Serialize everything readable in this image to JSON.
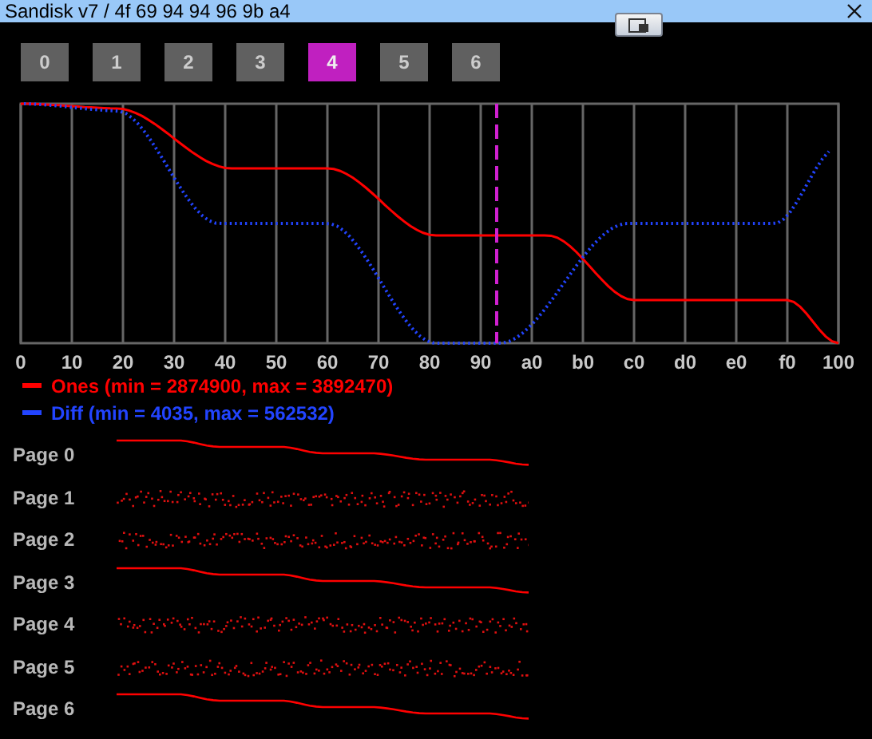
{
  "window": {
    "title": "Sandisk v7 / 4f 69 94 94 96 9b a4"
  },
  "page_buttons": [
    {
      "label": "0",
      "selected": false
    },
    {
      "label": "1",
      "selected": false
    },
    {
      "label": "2",
      "selected": false
    },
    {
      "label": "3",
      "selected": false
    },
    {
      "label": "4",
      "selected": true
    },
    {
      "label": "5",
      "selected": false
    },
    {
      "label": "6",
      "selected": false
    }
  ],
  "graph": {
    "x_labels": [
      "0",
      "10",
      "20",
      "30",
      "40",
      "50",
      "60",
      "70",
      "80",
      "90",
      "a0",
      "b0",
      "c0",
      "d0",
      "e0",
      "f0",
      "100"
    ],
    "legend": [
      {
        "label": "Ones (min = 2874900, max = 3892470)",
        "color": "#ff0000"
      },
      {
        "label": "Diff (min = 4035, max = 562532)",
        "color": "#2244ff"
      }
    ]
  },
  "pages": [
    {
      "label": "Page 0",
      "kind": "smooth"
    },
    {
      "label": "Page 1",
      "kind": "noise"
    },
    {
      "label": "Page 2",
      "kind": "noise"
    },
    {
      "label": "Page 3",
      "kind": "smooth"
    },
    {
      "label": "Page 4",
      "kind": "noise"
    },
    {
      "label": "Page 5",
      "kind": "noise"
    },
    {
      "label": "Page 6",
      "kind": "smooth"
    }
  ]
}
